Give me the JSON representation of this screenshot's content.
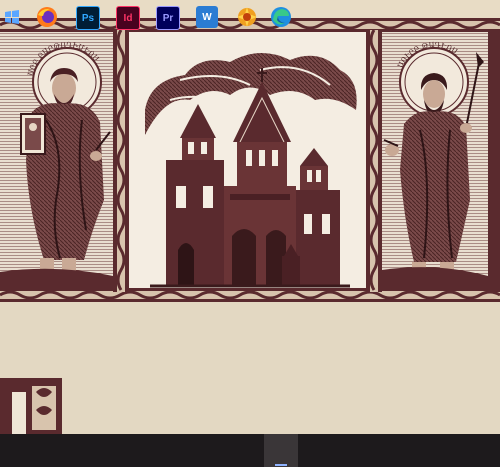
{
  "artwork": {
    "left_halo_text": "ՍՐԲ ԲԱՐԹՈՂԻՄԷՈՍ",
    "right_halo_text": "ՍՈՒՐԲ ԹԱԴԷՈՍ"
  },
  "taskbar": {
    "apps": [
      {
        "name": "Windows Start",
        "icon": "windows-start-icon",
        "label": ""
      },
      {
        "name": "Firefox",
        "icon": "firefox-icon",
        "label": ""
      },
      {
        "name": "Photoshop",
        "icon": "photoshop-icon",
        "label": "Ps"
      },
      {
        "name": "InDesign",
        "icon": "indesign-icon",
        "label": "Id"
      },
      {
        "name": "Premiere Pro",
        "icon": "premiere-icon",
        "label": "Pr"
      },
      {
        "name": "Word",
        "icon": "word-icon",
        "label": "W"
      },
      {
        "name": "XnView",
        "icon": "xnview-icon",
        "label": ""
      },
      {
        "name": "Edge",
        "icon": "edge-icon",
        "label": ""
      }
    ],
    "colors": {
      "bar": "#1d1a1c",
      "photoshop": "#31a8ff",
      "indesign": "#ff3366",
      "premiere": "#9999ff",
      "word": "#2b7cd3"
    }
  }
}
